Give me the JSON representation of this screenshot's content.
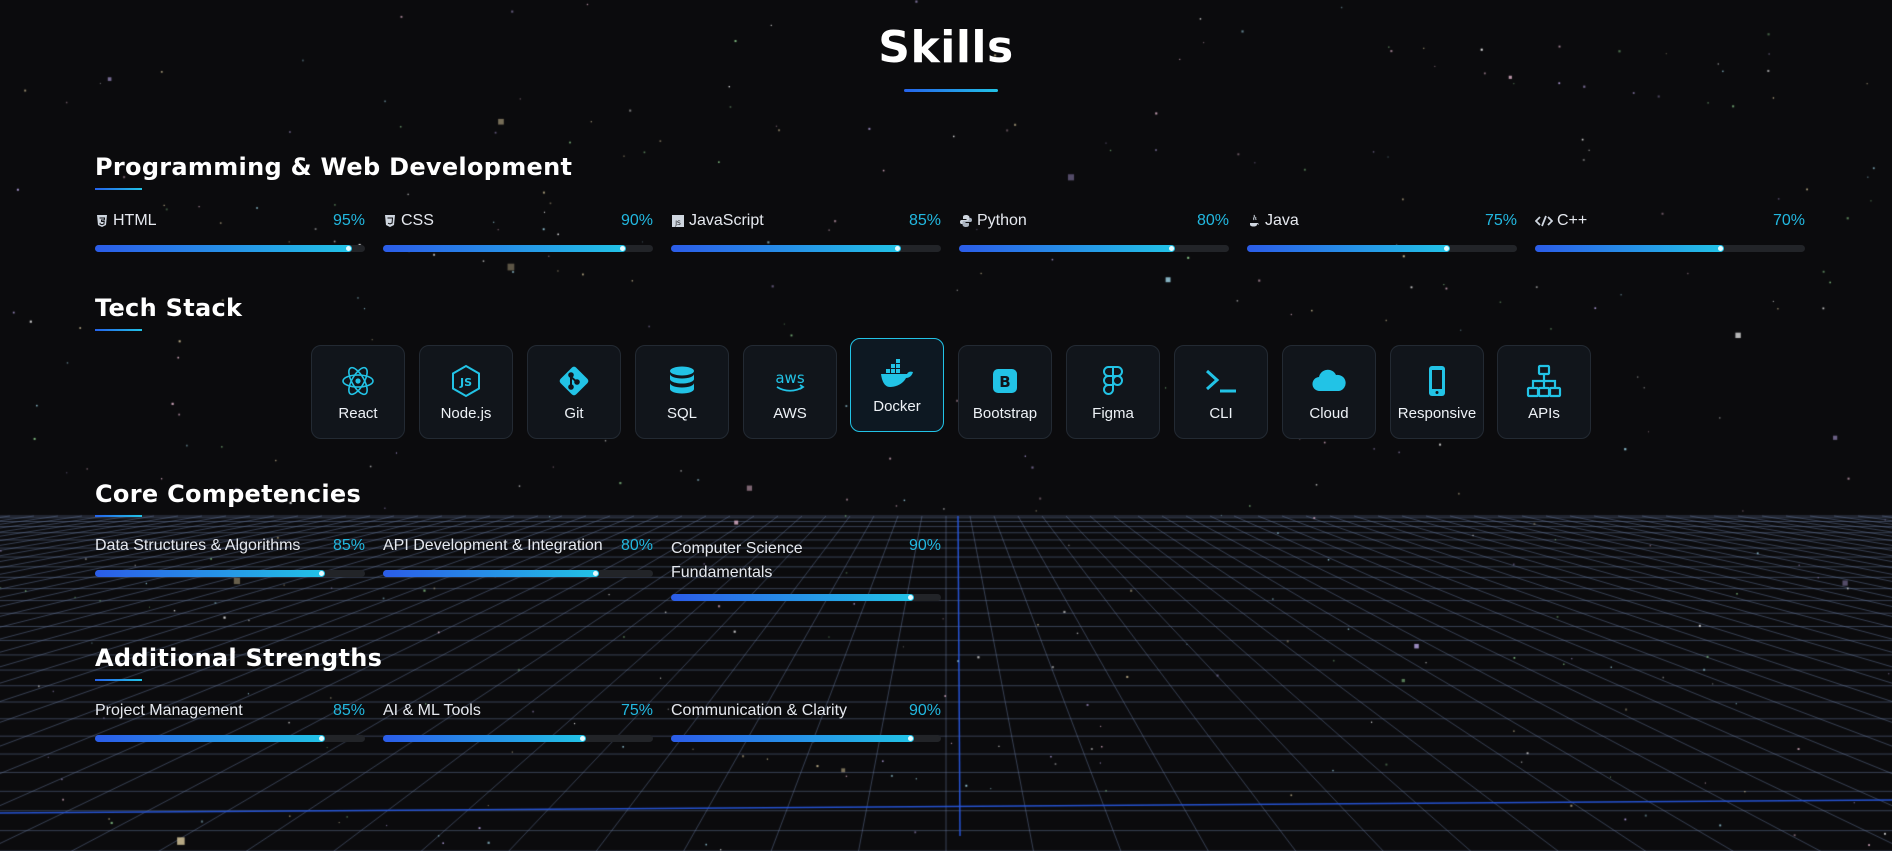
{
  "page": {
    "title": "Skills"
  },
  "colors": {
    "accent": "#22c3e6",
    "accent_start": "#2563eb",
    "background": "#0b0b0d",
    "card_bg": "#11151b"
  },
  "programming": {
    "title": "Programming & Web Development",
    "skills": [
      {
        "name": "HTML",
        "percent_label": "95%",
        "level": 95,
        "icon": "html5-icon"
      },
      {
        "name": "CSS",
        "percent_label": "90%",
        "level": 90,
        "icon": "css3-icon"
      },
      {
        "name": "JavaScript",
        "percent_label": "85%",
        "level": 85,
        "icon": "javascript-icon"
      },
      {
        "name": "Python",
        "percent_label": "80%",
        "level": 80,
        "icon": "python-icon"
      },
      {
        "name": "Java",
        "percent_label": "75%",
        "level": 75,
        "icon": "java-icon"
      },
      {
        "name": "C++",
        "percent_label": "70%",
        "level": 70,
        "icon": "code-icon"
      }
    ]
  },
  "tech_stack": {
    "title": "Tech Stack",
    "items": [
      {
        "label": "React",
        "icon": "react-icon"
      },
      {
        "label": "Node.js",
        "icon": "nodejs-icon"
      },
      {
        "label": "Git",
        "icon": "git-icon"
      },
      {
        "label": "SQL",
        "icon": "database-icon"
      },
      {
        "label": "AWS",
        "icon": "aws-icon"
      },
      {
        "label": "Docker",
        "icon": "docker-icon",
        "active": true
      },
      {
        "label": "Bootstrap",
        "icon": "bootstrap-icon"
      },
      {
        "label": "Figma",
        "icon": "figma-icon"
      },
      {
        "label": "CLI",
        "icon": "terminal-icon"
      },
      {
        "label": "Cloud",
        "icon": "cloud-icon"
      },
      {
        "label": "Responsive",
        "icon": "mobile-icon"
      },
      {
        "label": "APIs",
        "icon": "network-icon"
      }
    ]
  },
  "core": {
    "title": "Core Competencies",
    "skills": [
      {
        "name": "Data Structures & Algorithms",
        "percent_label": "85%",
        "level": 85
      },
      {
        "name": "API Development & Integration",
        "percent_label": "80%",
        "level": 80
      },
      {
        "name_line1": "Computer Science",
        "name_line2": "Fundamentals",
        "percent_label": "90%",
        "level": 90
      }
    ]
  },
  "additional": {
    "title": "Additional Strengths",
    "skills": [
      {
        "name": "Project Management",
        "percent_label": "85%",
        "level": 85
      },
      {
        "name": "AI & ML Tools",
        "percent_label": "75%",
        "level": 75
      },
      {
        "name": "Communication & Clarity",
        "percent_label": "90%",
        "level": 90
      }
    ]
  }
}
